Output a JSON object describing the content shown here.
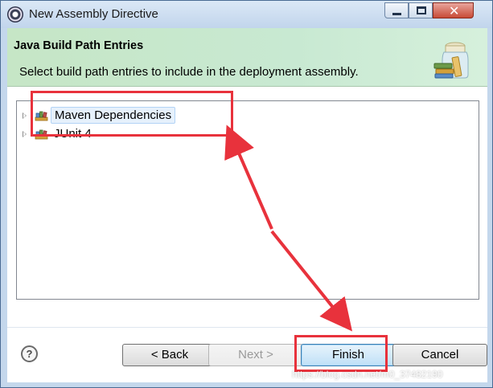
{
  "window": {
    "title": "New Assembly Directive",
    "minimize_icon": "minimize-icon",
    "maximize_icon": "maximize-icon",
    "close_icon": "close-icon",
    "close_glyph": "✕"
  },
  "header": {
    "title": "Java Build Path Entries",
    "message": "Select build path entries to include in the deployment assembly.",
    "icon": "library-jar-icon"
  },
  "tree": {
    "items": [
      {
        "label": "Maven Dependencies",
        "icon": "library-icon",
        "selected": true
      },
      {
        "label": "JUnit 4",
        "icon": "library-icon",
        "selected": false
      }
    ]
  },
  "footer": {
    "help_glyph": "?",
    "back_label": "< Back",
    "next_label": "Next >",
    "finish_label": "Finish",
    "cancel_label": "Cancel",
    "next_enabled": false
  },
  "annotations": {
    "color": "#e8323c",
    "watermark": "https://blog.csdn.net/m0_37482190"
  }
}
